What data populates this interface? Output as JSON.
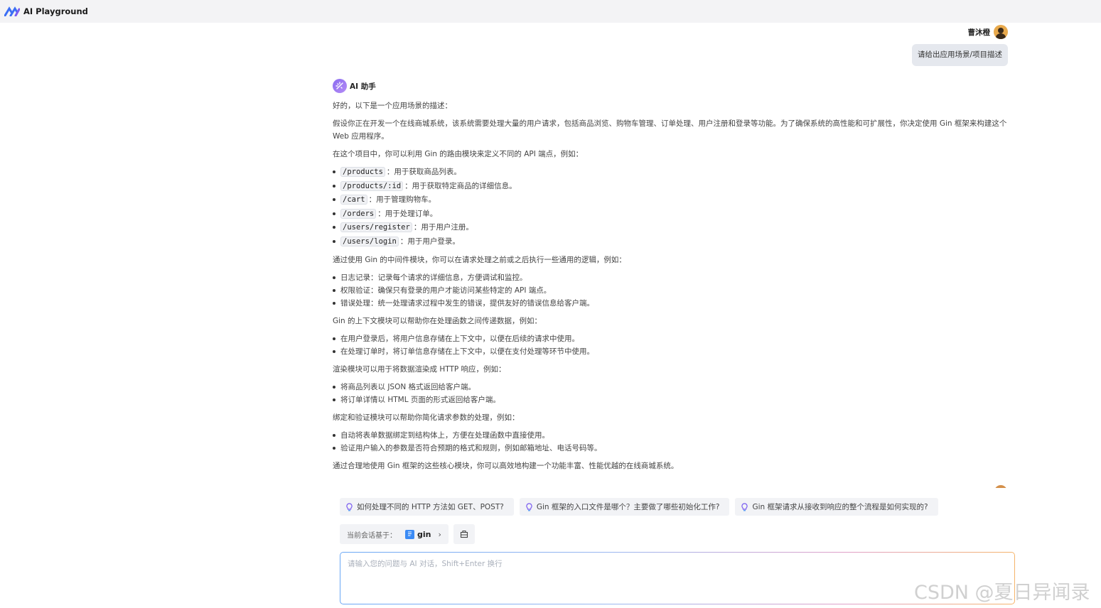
{
  "app": {
    "title": "AI Playground"
  },
  "user": {
    "name": "曹沐橙",
    "message": "请给出应用场景/项目描述"
  },
  "assistant": {
    "name": "AI 助手",
    "intro": "好的，以下是一个应用场景的描述：",
    "para1": "假设你正在开发一个在线商城系统，该系统需要处理大量的用户请求，包括商品浏览、购物车管理、订单处理、用户注册和登录等功能。为了确保系统的高性能和可扩展性，你决定使用 Gin 框架来构建这个 Web 应用程序。",
    "para2": "在这个项目中，你可以利用 Gin 的路由模块来定义不同的 API 端点，例如：",
    "routes": [
      {
        "code": "/products",
        "desc": "：用于获取商品列表。"
      },
      {
        "code": "/products/:id",
        "desc": "：用于获取特定商品的详细信息。"
      },
      {
        "code": "/cart",
        "desc": "：用于管理购物车。"
      },
      {
        "code": "/orders",
        "desc": "：用于处理订单。"
      },
      {
        "code": "/users/register",
        "desc": "：用于用户注册。"
      },
      {
        "code": "/users/login",
        "desc": "：用于用户登录。"
      }
    ],
    "para3": "通过使用 Gin 的中间件模块，你可以在请求处理之前或之后执行一些通用的逻辑，例如：",
    "middleware": [
      "日志记录：记录每个请求的详细信息，方便调试和监控。",
      "权限验证：确保只有登录的用户才能访问某些特定的 API 端点。",
      "错误处理：统一处理请求过程中发生的错误，提供友好的错误信息给客户端。"
    ],
    "para4": "Gin 的上下文模块可以帮助你在处理函数之间传递数据，例如：",
    "context": [
      "在用户登录后，将用户信息存储在上下文中，以便在后续的请求中使用。",
      "在处理订单时，将订单信息存储在上下文中，以便在支付处理等环节中使用。"
    ],
    "para5": "渲染模块可以用于将数据渲染成 HTTP 响应，例如：",
    "render": [
      "将商品列表以 JSON 格式返回给客户端。",
      "将订单详情以 HTML 页面的形式返回给客户端。"
    ],
    "para6": "绑定和验证模块可以帮助你简化请求参数的处理，例如：",
    "binding": [
      "自动将表单数据绑定到结构体上，方便在处理函数中直接使用。",
      "验证用户输入的参数是否符合预期的格式和规则，例如邮箱地址、电话号码等。"
    ],
    "para7": "通过合理地使用 Gin 框架的这些核心模块，你可以高效地构建一个功能丰富、性能优越的在线商城系统。"
  },
  "suggestions": [
    "如何处理不同的 HTTP 方法如 GET、POST?",
    "Gin 框架的入口文件是哪个？主要做了哪些初始化工作?",
    "Gin 框架请求从接收到响应的整个流程是如何实现的?"
  ],
  "context": {
    "label": "当前会话基于：",
    "kb_name": "gin"
  },
  "input": {
    "placeholder": "请输入您的问题与 AI 对话，Shift+Enter 换行"
  },
  "watermark": "CSDN @夏日异闻录",
  "colors": {
    "accent": "#3b8bf5",
    "ai_avatar": "#8a6cf0",
    "bubble": "#e5e8ee"
  },
  "icons": [
    "logo-icon",
    "user-avatar",
    "ai-avatar-icon",
    "bulb-icon",
    "document-icon",
    "chevron-right-icon",
    "settings-icon"
  ]
}
